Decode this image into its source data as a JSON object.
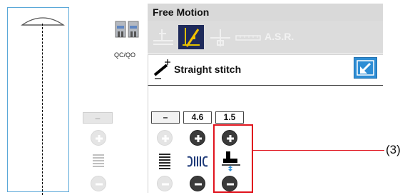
{
  "header": {
    "title": "Free Motion"
  },
  "modes": {
    "selected_index": 1,
    "asr_label": "A.S.R.",
    "items": [
      {
        "icon": "free-motion-echo-icon",
        "state": "disabled"
      },
      {
        "icon": "free-motion-needle-icon",
        "state": "selected"
      },
      {
        "icon": "free-motion-spring-icon",
        "state": "disabled"
      },
      {
        "icon": "ruler-icon",
        "state": "disabled"
      },
      {
        "icon": "asr-icon",
        "state": "disabled"
      }
    ]
  },
  "presser_foot": {
    "label": "QC/QO",
    "icon": "presser-foot-icon"
  },
  "stitch": {
    "name": "Straight stitch",
    "icon": "straight-stitch-icon",
    "expand_icon": "expand-arrow-icon"
  },
  "left_controls": {
    "value": "–"
  },
  "controls": {
    "col1_value": "–",
    "col2_value": "4.6",
    "col3_value": "1.5"
  },
  "callout": {
    "label": "(3)"
  },
  "colors": {
    "accent_blue": "#2e8dd4",
    "selected_mode": "#1e2a5a",
    "highlight_red": "#e0141e",
    "panel_gray": "#dcdcdc"
  }
}
